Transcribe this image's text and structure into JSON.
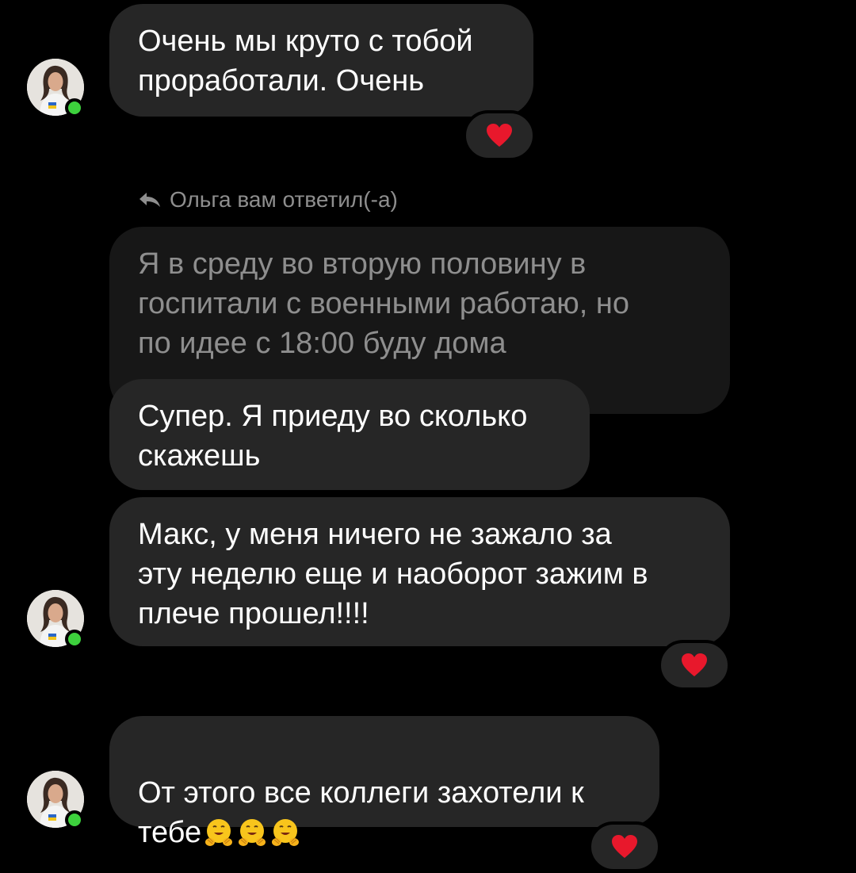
{
  "messages": {
    "m1": "Очень мы круто с тобой\nпроработали. Очень",
    "reply_note": "Ольга вам ответил(-а)",
    "quoted": "Я в среду во вторую половину в\nгоспитали с военными работаю, но\nпо идее с 18:00 буду дома",
    "m2": "Супер. Я приеду во сколько\nскажешь",
    "m3": "Макс, у меня ничего не зажало за\nэту неделю еще и наоборот зажим в\nплече прошел!!!!",
    "m4_text": "От этого все коллеги захотели к\nтебе"
  },
  "emojis": {
    "m4": [
      "hugging-face",
      "hugging-face",
      "hugging-face"
    ]
  },
  "reactions": {
    "m1": "heart",
    "m3": "heart",
    "m4": "heart"
  },
  "icons": {
    "reply": "reply-arrow-icon",
    "presence": "online-status-dot",
    "reaction": "heart-icon"
  },
  "colors": {
    "background": "#000000",
    "bubble": "#262626",
    "quoted_bubble": "#171717",
    "muted_text": "#8e8e8e",
    "online": "#3dd13d",
    "heart": "#e8182c"
  }
}
